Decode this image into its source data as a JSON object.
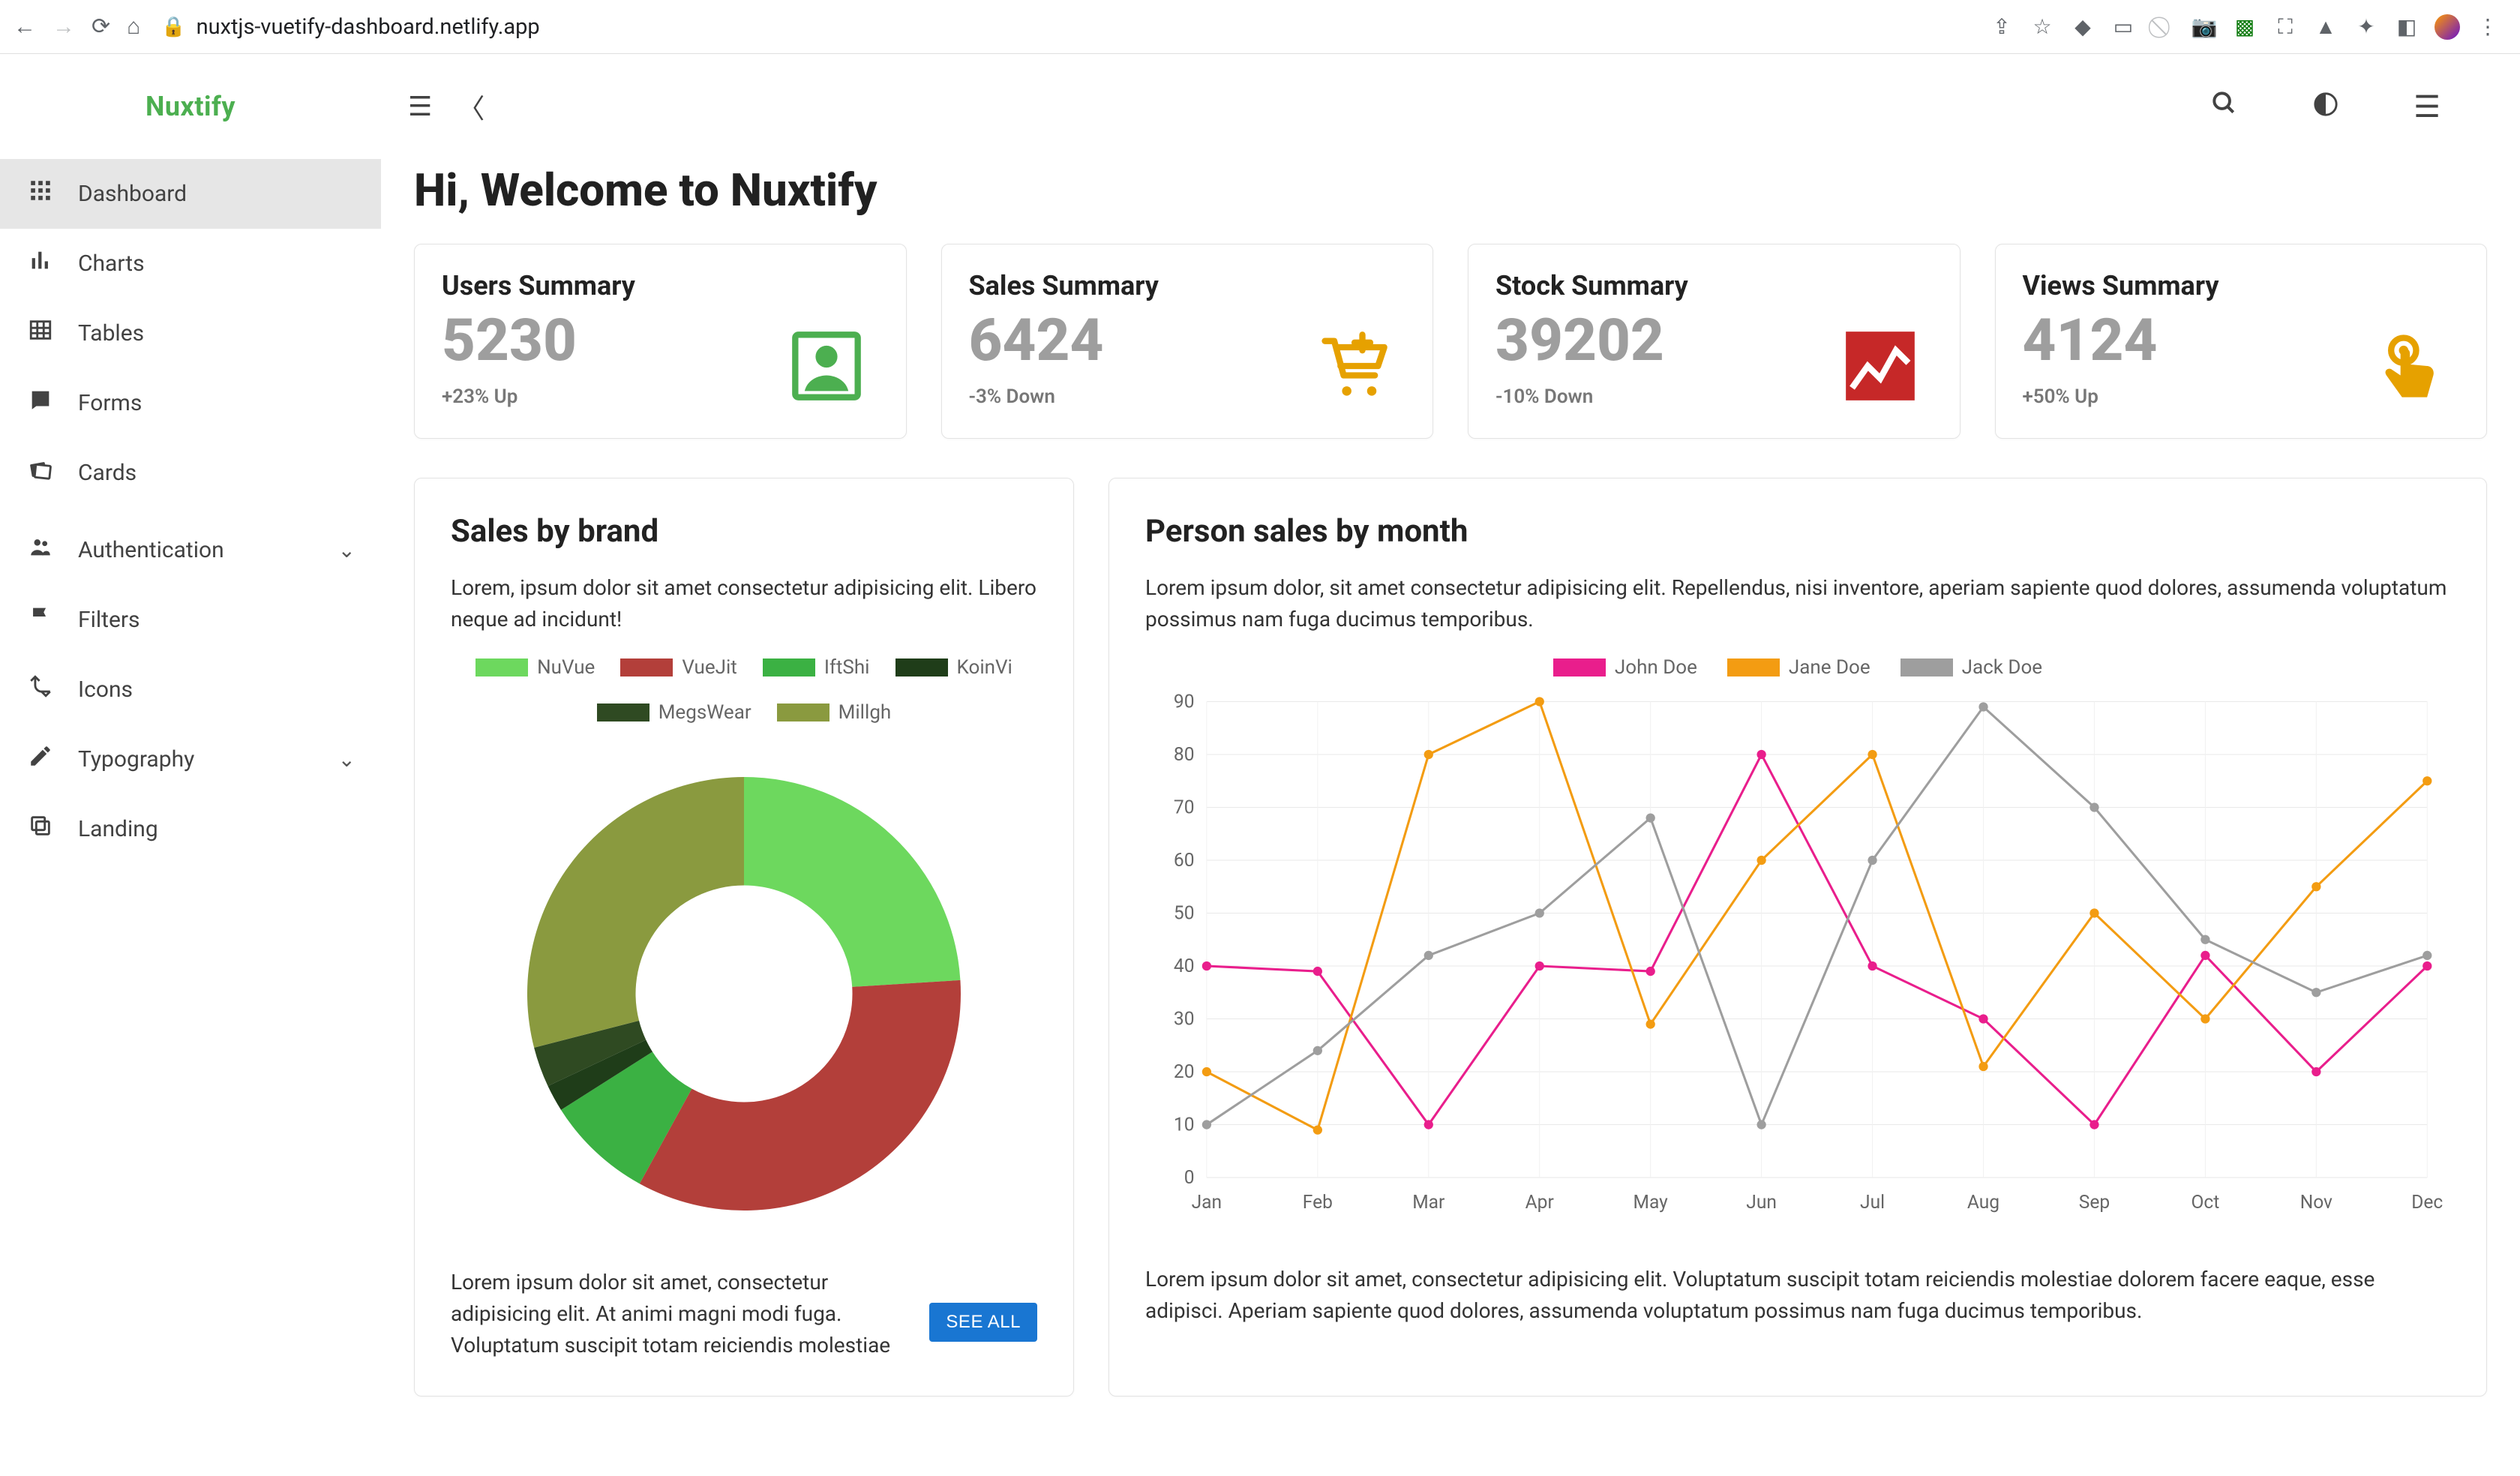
{
  "browser": {
    "url_host": "nuxtjs-vuetify-dashboard.netlify.app"
  },
  "brand": {
    "name": "Nuxtify"
  },
  "sidebar": {
    "items": [
      {
        "label": "Dashboard",
        "icon": "apps",
        "active": true,
        "expandable": false
      },
      {
        "label": "Charts",
        "icon": "bar_chart",
        "active": false,
        "expandable": false
      },
      {
        "label": "Tables",
        "icon": "table",
        "active": false,
        "expandable": false
      },
      {
        "label": "Forms",
        "icon": "forms",
        "active": false,
        "expandable": false
      },
      {
        "label": "Cards",
        "icon": "cards",
        "active": false,
        "expandable": false
      },
      {
        "label": "Authentication",
        "icon": "people",
        "active": false,
        "expandable": true
      },
      {
        "label": "Filters",
        "icon": "flag",
        "active": false,
        "expandable": false
      },
      {
        "label": "Icons",
        "icon": "icons",
        "active": false,
        "expandable": false
      },
      {
        "label": "Typography",
        "icon": "edit",
        "active": false,
        "expandable": true
      },
      {
        "label": "Landing",
        "icon": "copy",
        "active": false,
        "expandable": false
      }
    ]
  },
  "header": {
    "title": "Hi, Welcome to Nuxtify"
  },
  "summary": [
    {
      "title": "Users Summary",
      "value": "5230",
      "delta": "+23% Up",
      "icon": "user-box",
      "color": "#4caf50"
    },
    {
      "title": "Sales Summary",
      "value": "6424",
      "delta": "-3% Down",
      "icon": "cart-plus",
      "color": "#e6a100"
    },
    {
      "title": "Stock Summary",
      "value": "39202",
      "delta": "-10% Down",
      "icon": "stock-line",
      "color": "#c62828"
    },
    {
      "title": "Views Summary",
      "value": "4124",
      "delta": "+50% Up",
      "icon": "touch",
      "color": "#e6a100"
    }
  ],
  "brand_panel": {
    "title": "Sales by brand",
    "intro": "Lorem, ipsum dolor sit amet consectetur adipisicing elit. Libero neque ad incidunt!",
    "see_all": "SEE ALL",
    "footer": "Lorem ipsum dolor sit amet, consectetur adipisicing elit. At animi magni modi fuga. Voluptatum suscipit totam reiciendis molestiae"
  },
  "sales_panel": {
    "title": "Person sales by month",
    "intro": "Lorem ipsum dolor, sit amet consectetur adipisicing elit. Repellendus, nisi inventore, aperiam sapiente quod dolores, assumenda voluptatum possimus nam fuga ducimus temporibus.",
    "footer": "Lorem ipsum dolor sit amet, consectetur adipisicing elit. Voluptatum suscipit totam reiciendis molestiae dolorem facere eaque, esse adipisci. Aperiam sapiente quod dolores, assumenda voluptatum possimus nam fuga ducimus temporibus."
  },
  "chart_data": [
    {
      "type": "pie",
      "title": "Sales by brand",
      "series": [
        {
          "name": "NuVue",
          "value": 24,
          "color": "#6dd85e"
        },
        {
          "name": "VueJit",
          "value": 34,
          "color": "#b33f3a"
        },
        {
          "name": "IftShi",
          "value": 8,
          "color": "#3bb143"
        },
        {
          "name": "KoinVi",
          "value": 2,
          "color": "#1f3d19"
        },
        {
          "name": "MegsWear",
          "value": 3,
          "color": "#2f4a22"
        },
        {
          "name": "Millgh",
          "value": 29,
          "color": "#8a9a3f"
        }
      ]
    },
    {
      "type": "line",
      "title": "Person sales by month",
      "xlabel": "",
      "ylabel": "",
      "ylim": [
        0,
        90
      ],
      "categories": [
        "Jan",
        "Feb",
        "Mar",
        "Apr",
        "May",
        "Jun",
        "Jul",
        "Aug",
        "Sep",
        "Oct",
        "Nov",
        "Dec"
      ],
      "series": [
        {
          "name": "John Doe",
          "color": "#e91e8c",
          "values": [
            40,
            39,
            10,
            40,
            39,
            80,
            40,
            30,
            10,
            42,
            20,
            40
          ]
        },
        {
          "name": "Jane Doe",
          "color": "#f39c12",
          "values": [
            20,
            9,
            80,
            90,
            29,
            60,
            80,
            21,
            50,
            30,
            55,
            75
          ]
        },
        {
          "name": "Jack Doe",
          "color": "#9e9e9e",
          "values": [
            10,
            24,
            42,
            50,
            68,
            10,
            60,
            89,
            70,
            45,
            35,
            42
          ]
        }
      ]
    }
  ]
}
